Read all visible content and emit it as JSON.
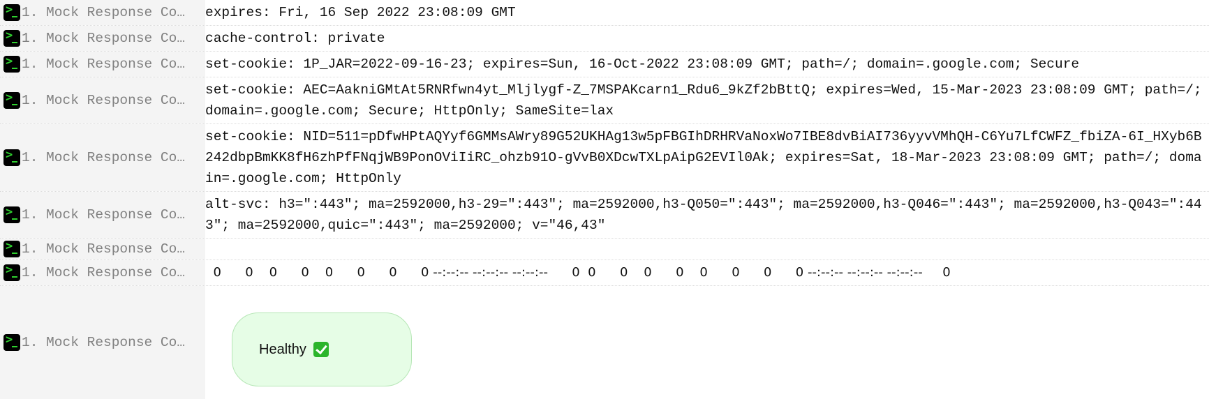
{
  "log": {
    "source_label": "1. Mock Response Co…",
    "rows": [
      {
        "text": "expires: Fri, 16 Sep 2022 23:08:09 GMT"
      },
      {
        "text": "cache-control: private"
      },
      {
        "text": "set-cookie: 1P_JAR=2022-09-16-23; expires=Sun, 16-Oct-2022 23:08:09 GMT; path=/; domain=.google.com; Secure"
      },
      {
        "text": "set-cookie: AEC=AakniGMtAt5RNRfwn4yt_Mljlygf-Z_7MSPAKcarn1_Rdu6_9kZf2bBttQ; expires=Wed, 15-Mar-2023 23:08:09 GMT; path=/; domain=.google.com; Secure; HttpOnly; SameSite=lax"
      },
      {
        "text": "set-cookie: NID=511=pDfwHPtAQYyf6GMMsAWry89G52UKHAg13w5pFBGIhDRHRVaNoxWo7IBE8dvBiAI736yyvVMhQH-C6Yu7LfCWFZ_fbiZA-6I_HXyb6B242dbpBmKK8fH6zhPfFNqjWB9PonOViIiRC_ohzb91O-gVvB0XDcwTXLpAipG2EVIl0Ak; expires=Sat, 18-Mar-2023 23:08:09 GMT; path=/; domain=.google.com; HttpOnly"
      },
      {
        "text": "alt-svc: h3=\":443\"; ma=2592000,h3-29=\":443\"; ma=2592000,h3-Q050=\":443\"; ma=2592000,h3-Q046=\":443\"; ma=2592000,h3-Q043=\":443\"; ma=2592000,quic=\":443\"; ma=2592000; v=\"46,43\""
      },
      {
        "text": ""
      },
      {
        "text": "  0      0    0      0    0      0      0      0 --:--:-- --:--:-- --:--:--      0  0      0    0      0    0      0      0      0 --:--:-- --:--:-- --:--:--     0"
      }
    ],
    "status_badge": {
      "label": "Healthy",
      "icon": "check-mark-button-icon"
    }
  }
}
